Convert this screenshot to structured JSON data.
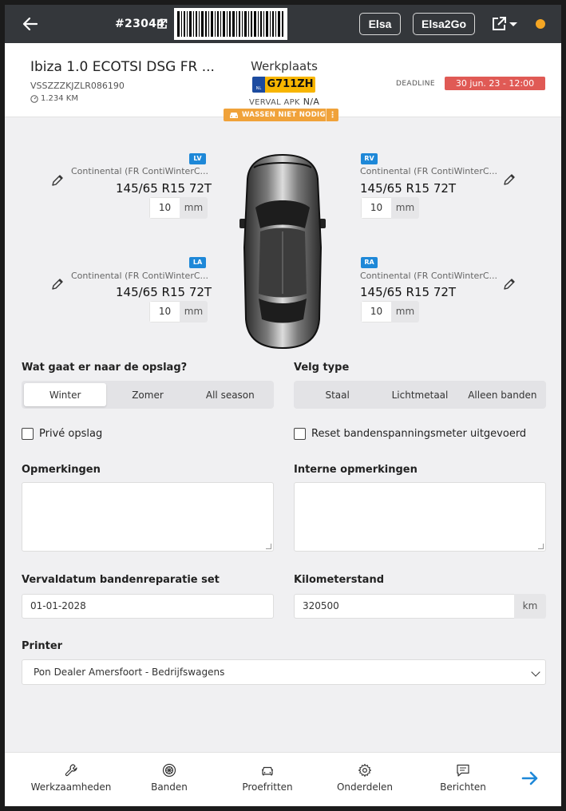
{
  "topbar": {
    "order_number": "#23044",
    "elsa_label": "Elsa",
    "elsa2go_label": "Elsa2Go",
    "status_color": "#f5a623"
  },
  "vehicle": {
    "title": "Ibiza 1.0 ECOTSI DSG FR ...",
    "vin": "VSSZZZKJZLR086190",
    "km": "1.234 KM",
    "location": "Werkplaats",
    "plate_country": "NL",
    "plate": "G711ZH",
    "apk_label": "VERVAL APK",
    "apk_value": "N/A",
    "deadline_label": "DEADLINE",
    "deadline_value": "30 jun. 23 - 12:00",
    "wash_label": "WASSEN NIET NODIG"
  },
  "tires": {
    "lv": {
      "tag": "LV",
      "brand": "Continental (FR ContiWinterC...",
      "size": "145/65 R15 72T",
      "tread": "10",
      "unit": "mm"
    },
    "rv": {
      "tag": "RV",
      "brand": "Continental (FR ContiWinterC...",
      "size": "145/65 R15 72T",
      "tread": "10",
      "unit": "mm"
    },
    "la": {
      "tag": "LA",
      "brand": "Continental (FR ContiWinterC...",
      "size": "145/65 R15 72T",
      "tread": "10",
      "unit": "mm"
    },
    "ra": {
      "tag": "RA",
      "brand": "Continental (FR ContiWinterC...",
      "size": "145/65 R15 72T",
      "tread": "10",
      "unit": "mm"
    }
  },
  "form": {
    "storage_label": "Wat gaat er naar de opslag?",
    "storage_options": [
      "Winter",
      "Zomer",
      "All season"
    ],
    "storage_selected": "Winter",
    "rim_label": "Velg type",
    "rim_options": [
      "Staal",
      "Lichtmetaal",
      "Alleen banden"
    ],
    "private_label": "Privé opslag",
    "reset_label": "Reset bandenspanningsmeter uitgevoerd",
    "remarks_label": "Opmerkingen",
    "internal_remarks_label": "Interne opmerkingen",
    "repair_date_label": "Vervaldatum bandenreparatie set",
    "repair_date_value": "01-01-2028",
    "mileage_label": "Kilometerstand",
    "mileage_value": "320500",
    "mileage_unit": "km",
    "printer_label": "Printer",
    "printer_value": "Pon Dealer Amersfoort - Bedrijfswagens"
  },
  "nav": {
    "items": [
      "Werkzaamheden",
      "Banden",
      "Proefritten",
      "Onderdelen",
      "Berichten"
    ],
    "icons": [
      "wrench-icon",
      "wheel-icon",
      "car-icon",
      "gear-icon",
      "message-icon",
      "arrow-right-icon"
    ],
    "accent": "#1e88d8"
  }
}
